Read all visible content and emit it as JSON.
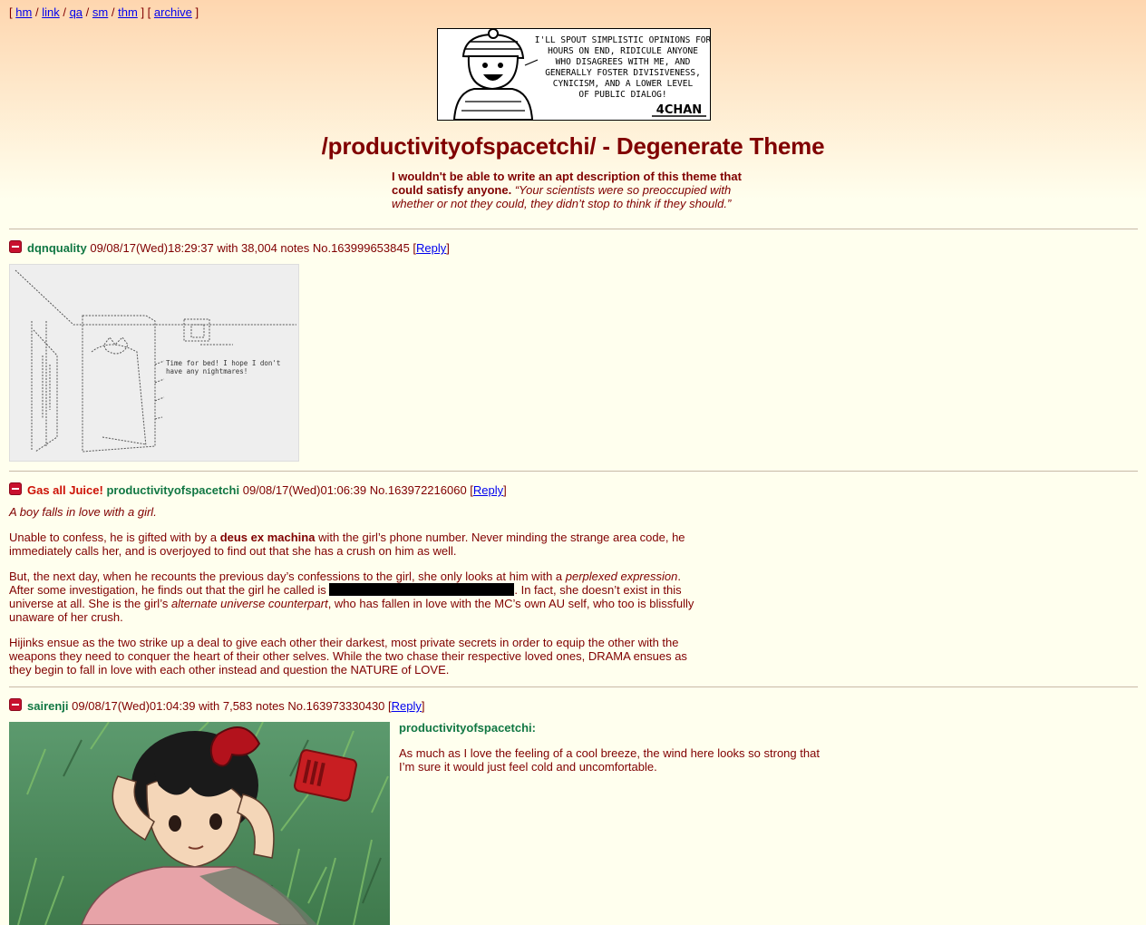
{
  "nav": {
    "open": "[",
    "links": [
      "hm",
      "link",
      "qa",
      "sm",
      "thm"
    ],
    "sep": "/",
    "mid": "] [",
    "archive": "archive",
    "close": "]"
  },
  "banner": {
    "lines": [
      "I'LL SPOUT SIMPLISTIC OPINIONS FOR",
      "HOURS ON END, RIDICULE ANYONE",
      "WHO DISAGREES WITH ME, AND",
      "GENERALLY FOSTER DIVISIVENESS,",
      "CYNICISM, AND A LOWER LEVEL",
      "OF PUBLIC DIALOG!"
    ],
    "signature": "4CHAN"
  },
  "board": {
    "title": "/productivityofspacetchi/ - Degenerate Theme",
    "desc_bold": "I wouldn't be able to write an apt description of this theme that could satisfy anyone.",
    "desc_quote": "“Your scientists were so preoccupied with whether or not they could, they didn’t stop to think if they should.”"
  },
  "posts": [
    {
      "name": "dqnquality",
      "meta": "09/08/17(Wed)18:29:37 with 38,004 notes No.163999653845 [",
      "reply": "Reply",
      "close": "]",
      "image_caption": "Time for bed! I hope I don't have any nightmares!"
    },
    {
      "subject": "Gas all Juice!",
      "name": "productivityofspacetchi",
      "meta": "09/08/17(Wed)01:06:39 No.163972216060 [",
      "reply": "Reply",
      "close": "]",
      "p1": "A boy falls in love with a girl.",
      "p2a": "Unable to confess, he is gifted with by a ",
      "p2b": "deus ex machina",
      "p2c": " with the girl’s phone number. Never minding the strange area code, he immediately calls her, and is overjoyed to find out that she has a crush on him as well.",
      "p3a": "But, the next day, when he recounts the previous day’s confessions to the girl, she only looks at him with a ",
      "p3b": "perplexed expression",
      "p3c": ". After some investigation, he finds out that the girl he called is ",
      "p3d": ". In fact, she doesn’t exist in this universe at all. She is the girl’s ",
      "p3e": "alternate universe counterpart",
      "p3f": ", who has fallen in love with the MC’s own AU self, who too is blissfully unaware of her crush.",
      "p4": "Hijinks ensue as the two strike up a deal to give each other their darkest, most private secrets in order to equip the other with the weapons they need to conquer the heart of their other selves. While the two chase their respective loved ones, DRAMA ensues as they begin to fall in love with each other instead and question the NATURE of LOVE."
    },
    {
      "name": "sairenji",
      "meta": "09/08/17(Wed)01:04:39 with 7,583 notes No.163973330430 [",
      "reply": "Reply",
      "close": "]",
      "quote_name": "productivityofspacetchi:",
      "text": "As much as I love the feeling of a cool breeze, the wind here looks so strong that I’m sure it would just feel cold and uncomfortable."
    }
  ]
}
